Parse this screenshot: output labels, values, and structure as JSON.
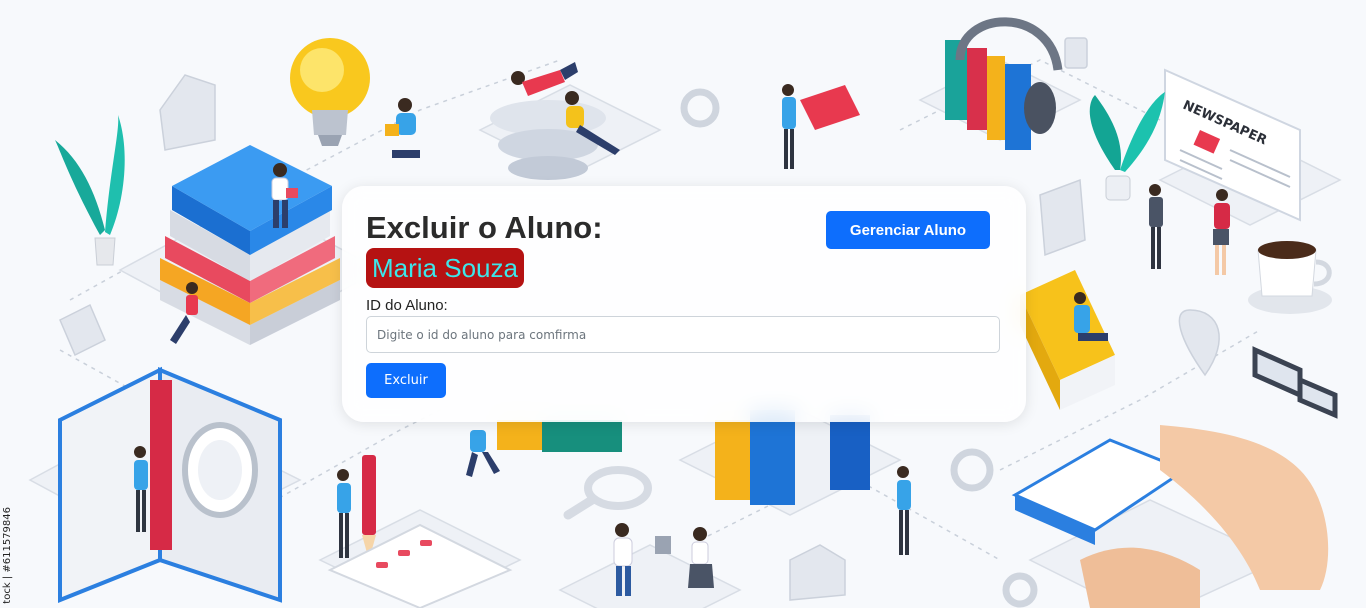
{
  "card": {
    "title": "Excluir o Aluno:",
    "student_name": "Maria Souza",
    "manage_button": "Gerenciar Aluno",
    "id_label": "ID do Aluno:",
    "id_placeholder": "Digite o id do aluno para comfirma",
    "id_value": "",
    "delete_button": "Excluir"
  },
  "background": {
    "newspaper_text": "NEWSPAPER",
    "watermark": "tock | #611579846"
  },
  "colors": {
    "primary": "#0d6efd",
    "name_badge_bg": "#b51212",
    "name_badge_text": "#3de6ea"
  }
}
